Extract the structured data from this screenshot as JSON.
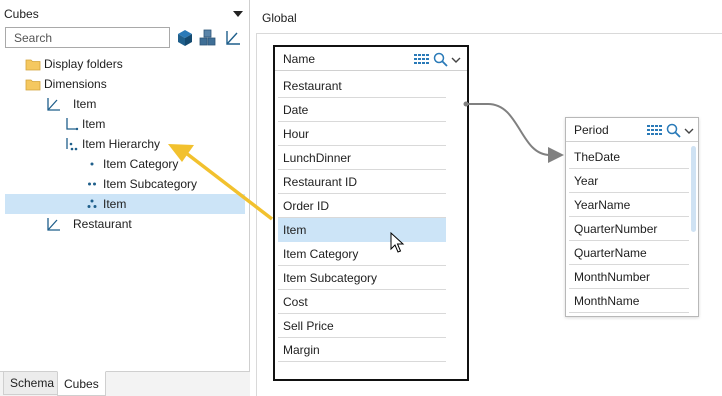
{
  "left_panel": {
    "cube_selector": {
      "value": "Cubes"
    },
    "search": {
      "placeholder": "Search",
      "value": ""
    },
    "tree": {
      "display_folders": "Display folders",
      "dimensions": "Dimensions",
      "item_dimension": "Item",
      "item_level": "Item",
      "item_hierarchy": "Item Hierarchy",
      "item_category": "Item Category",
      "item_subcategory": "Item Subcategory",
      "item_leaf": "Item",
      "restaurant": "Restaurant"
    },
    "tabs": [
      "Schema",
      "Cubes"
    ],
    "active_tab": "Cubes"
  },
  "canvas": {
    "group_title": "Global",
    "main_table": {
      "header": "Name",
      "rows": [
        "Restaurant",
        "Date",
        "Hour",
        "LunchDinner",
        "Restaurant ID",
        "Order ID",
        "Item",
        "Item Category",
        "Item Subcategory",
        "Cost",
        "Sell Price",
        "Margin"
      ],
      "hover_row": "Item"
    },
    "period_table": {
      "header": "Period",
      "rows": [
        "TheDate",
        "Year",
        "YearName",
        "QuarterNumber",
        "QuarterName",
        "MonthNumber",
        "MonthName"
      ]
    }
  },
  "colors": {
    "selection": "#cce4f7",
    "highlight_arrow": "#f2c12e",
    "link_line": "#808080",
    "icon_blue": "#1f5f8b"
  }
}
